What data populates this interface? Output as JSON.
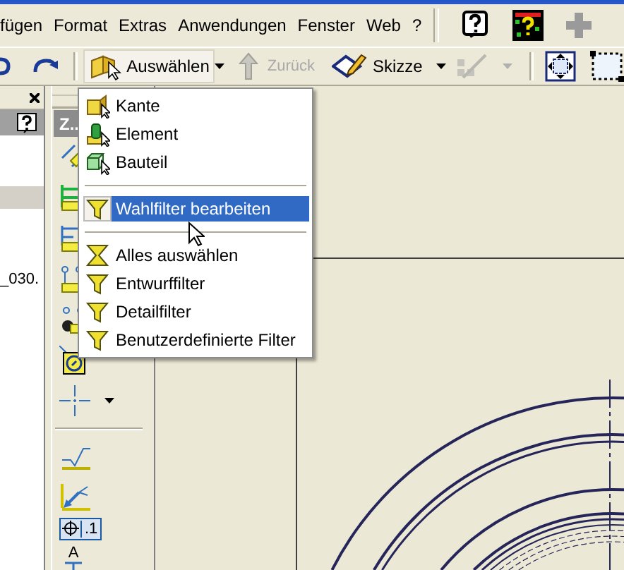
{
  "menubar": {
    "items": [
      "fügen",
      "Format",
      "Extras",
      "Anwendungen",
      "Fenster",
      "Web",
      "?"
    ]
  },
  "toolbar": {
    "select_button": "Auswählen",
    "back_button": {
      "label": "Zurück",
      "disabled": true
    },
    "sketch_button": "Skizze"
  },
  "browser_panel": {
    "row_text": "_030."
  },
  "tool_panel": {
    "title": "Z..",
    "tolerance_label": ".1",
    "datum_label": "A"
  },
  "select_menu": {
    "groups": [
      [
        {
          "label": "Kante",
          "kind": "edge",
          "selected": false
        },
        {
          "label": "Element",
          "kind": "feature",
          "selected": false
        },
        {
          "label": "Bauteil",
          "kind": "part",
          "selected": false
        }
      ],
      [
        {
          "label": "Wahlfilter bearbeiten",
          "kind": "filter",
          "selected": true
        }
      ],
      [
        {
          "label": "Alles auswählen",
          "kind": "select-all",
          "selected": false
        },
        {
          "label": "Entwurffilter",
          "kind": "filter",
          "selected": false
        },
        {
          "label": "Detailfilter",
          "kind": "filter",
          "selected": false
        },
        {
          "label": "Benutzerdefinierte Filter",
          "kind": "filter",
          "selected": false
        }
      ]
    ]
  }
}
